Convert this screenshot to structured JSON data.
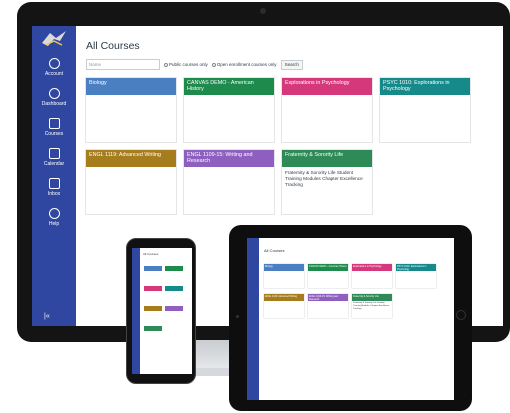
{
  "page": {
    "title": "All Courses"
  },
  "search": {
    "placeholder": "Name"
  },
  "filters": {
    "public": "Public courses only",
    "open": "Open enrollment courses only",
    "button": "Search"
  },
  "nav": {
    "items": [
      {
        "label": "Account",
        "icon": "account-icon"
      },
      {
        "label": "Dashboard",
        "icon": "dashboard-icon"
      },
      {
        "label": "Courses",
        "icon": "courses-icon"
      },
      {
        "label": "Calendar",
        "icon": "calendar-icon"
      },
      {
        "label": "Inbox",
        "icon": "inbox-icon"
      },
      {
        "label": "Help",
        "icon": "help-icon"
      }
    ],
    "collapse": "|«"
  },
  "courses": [
    {
      "title": "Biology",
      "color": "#4a7fc1",
      "body": ""
    },
    {
      "title": "CANVAS DEMO - American History",
      "color": "#1e8a4c",
      "body": ""
    },
    {
      "title": "Explorations in Psychology",
      "color": "#d6397b",
      "body": ""
    },
    {
      "title": "PSYC 1010: Explorations in Psychology",
      "color": "#168a8a",
      "body": ""
    },
    {
      "title": "ENGL 1119: Advanced Writing",
      "color": "#a67d1c",
      "body": ""
    },
    {
      "title": "ENGL 1109-15: Writing and Research",
      "color": "#8e5fbf",
      "body": ""
    },
    {
      "title": "Fraternity & Sorority Life",
      "color": "#2e8b57",
      "body": "Fraternity & Sorority Life Student Training Modules Chapter Excellence Tracking"
    }
  ],
  "tablet": {
    "title": "All Courses"
  },
  "phone": {
    "title": "All Courses"
  }
}
